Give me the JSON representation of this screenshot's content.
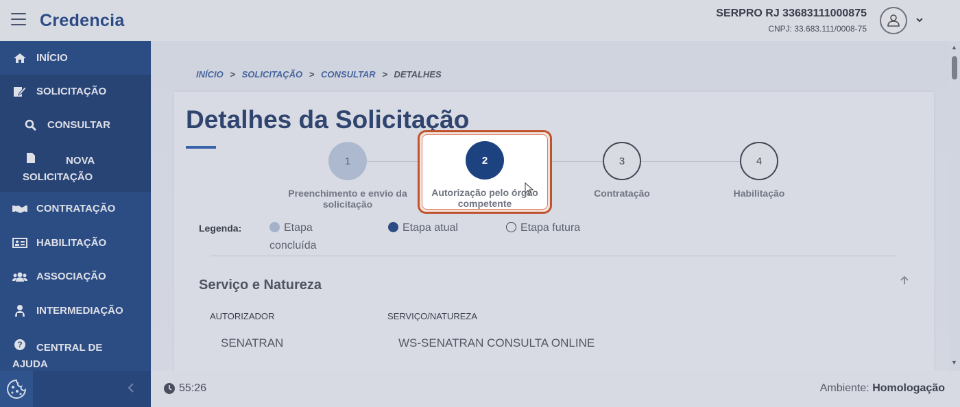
{
  "header": {
    "logo": "Credencia",
    "org_name": "SERPRO RJ 33683111000875",
    "org_cnpj": "CNPJ: 33.683.111/0008-75"
  },
  "sidebar": {
    "items": [
      {
        "label": "INÍCIO",
        "icon": "home-icon"
      },
      {
        "label": "SOLICITAÇÃO",
        "icon": "edit-document-icon"
      },
      {
        "label": "CONSULTAR",
        "icon": "search-icon"
      },
      {
        "label": "NOVA SOLICITAÇÃO",
        "icon": "file-icon"
      },
      {
        "label": "CONTRATAÇÃO",
        "icon": "handshake-icon"
      },
      {
        "label": "HABILITAÇÃO",
        "icon": "id-card-icon"
      },
      {
        "label": "ASSOCIAÇÃO",
        "icon": "users-icon"
      },
      {
        "label": "INTERMEDIAÇÃO",
        "icon": "person-laptop-icon"
      },
      {
        "label": "CENTRAL DE AJUDA",
        "icon": "help-icon"
      }
    ]
  },
  "breadcrumb": {
    "items": [
      "INÍCIO",
      "SOLICITAÇÃO",
      "CONSULTAR",
      "DETALHES"
    ],
    "sep": ">"
  },
  "page": {
    "title": "Detalhes da Solicitação"
  },
  "steps": [
    {
      "number": "1",
      "label": "Preenchimento e envio da solicitação",
      "state": "concluída"
    },
    {
      "number": "2",
      "label": "Autorização pelo órgão competente",
      "state": "atual"
    },
    {
      "number": "3",
      "label": "Contratação",
      "state": "futura"
    },
    {
      "number": "4",
      "label": "Habilitação",
      "state": "futura"
    }
  ],
  "legend": {
    "label": "Legenda:",
    "done": "Etapa concluída",
    "current": "Etapa atual",
    "future": "Etapa futura"
  },
  "section": {
    "title": "Serviço e Natureza",
    "col1_header": "AUTORIZADOR",
    "col2_header": "SERVIÇO/NATUREZA",
    "col1_value": "SENATRAN",
    "col2_value": "WS-SENATRAN CONSULTA ONLINE"
  },
  "footer": {
    "timer": "55:26",
    "env_label": "Ambiente:",
    "env_value": "Homologação"
  },
  "colors": {
    "primary": "#1c4280",
    "highlight": "#c0532f"
  }
}
